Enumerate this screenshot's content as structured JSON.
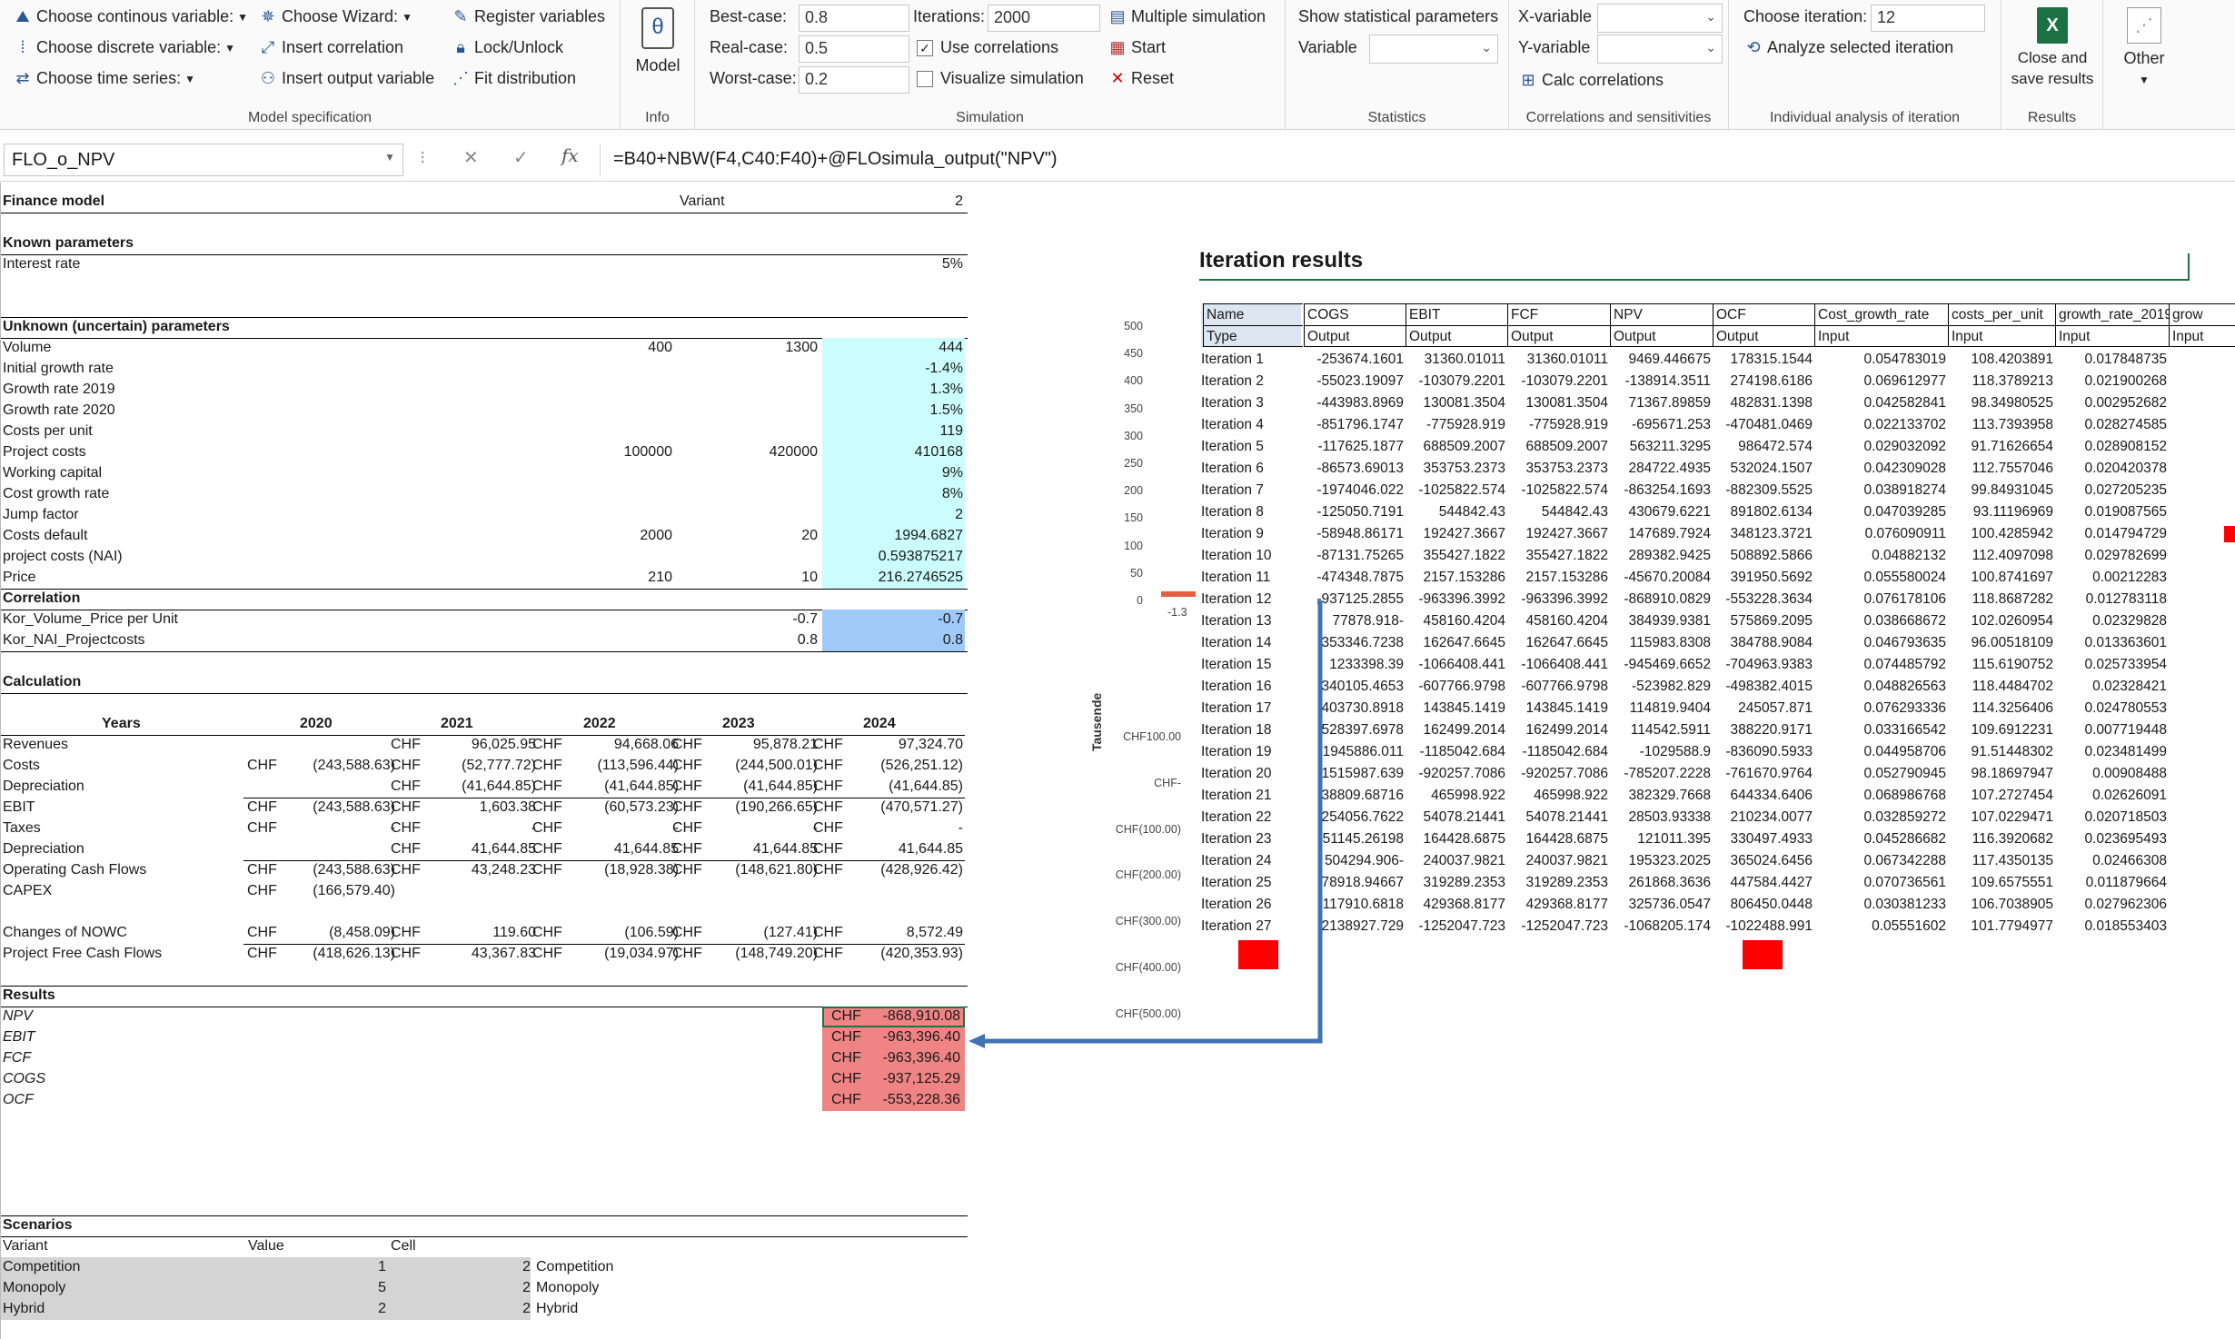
{
  "ribbon": {
    "model_spec": {
      "choose_continuous": "Choose continous variable:",
      "choose_discrete": "Choose discrete variable:",
      "choose_time_series": "Choose time series:",
      "choose_wizard": "Choose Wizard:",
      "insert_correlation": "Insert correlation",
      "insert_output": "Insert output variable",
      "register_variables": "Register variables",
      "lock_unlock": "Lock/Unlock",
      "fit_distribution": "Fit distribution",
      "group_label": "Model specification"
    },
    "info": {
      "model": "Model",
      "group_label": "Info"
    },
    "simulation": {
      "best_case_label": "Best-case:",
      "best_case_value": "0.8",
      "real_case_label": "Real-case:",
      "real_case_value": "0.5",
      "worst_case_label": "Worst-case:",
      "worst_case_value": "0.2",
      "iterations_label": "Iterations:",
      "iterations_value": "2000",
      "use_correlations": "Use correlations",
      "visualize": "Visualize simulation",
      "multiple": "Multiple simulation",
      "start": "Start",
      "reset": "Reset",
      "group_label": "Simulation"
    },
    "statistics": {
      "show_params": "Show statistical parameters",
      "variable": "Variable",
      "group_label": "Statistics"
    },
    "correlations": {
      "x_variable": "X-variable",
      "y_variable": "Y-variable",
      "calc": "Calc correlations",
      "group_label": "Correlations and sensitivities"
    },
    "iteration": {
      "choose_label": "Choose iteration:",
      "choose_value": "12",
      "analyze": "Analyze selected iteration",
      "group_label": "Individual analysis of iteration"
    },
    "results": {
      "close_save": "Close and save results",
      "group_label": "Results"
    },
    "other": {
      "label": "Other"
    }
  },
  "formula_bar": {
    "name_box": "FLO_o_NPV",
    "formula": "=B40+NBW(F4,C40:F40)+@FLOsimula_output(\"NPV\")"
  },
  "model": {
    "title": "Finance model",
    "variant_label": "Variant",
    "variant_value": "2",
    "known_header": "Known parameters",
    "interest_label": "Interest rate",
    "interest_value": "5%",
    "unknown_header": "Unknown (uncertain) parameters",
    "params": [
      {
        "name": "Volume",
        "a": "400",
        "b": "1300",
        "v": "444"
      },
      {
        "name": "Initial growth rate",
        "a": "",
        "b": "",
        "v": "-1.4%"
      },
      {
        "name": "Growth rate 2019",
        "a": "",
        "b": "",
        "v": "1.3%"
      },
      {
        "name": "Growth rate 2020",
        "a": "",
        "b": "",
        "v": "1.5%"
      },
      {
        "name": "Costs per unit",
        "a": "",
        "b": "",
        "v": "119"
      },
      {
        "name": "Project costs",
        "a": "100000",
        "b": "420000",
        "v": "410168"
      },
      {
        "name": "Working capital",
        "a": "",
        "b": "",
        "v": "9%"
      },
      {
        "name": "Cost growth rate",
        "a": "",
        "b": "",
        "v": "8%"
      },
      {
        "name": "Jump factor",
        "a": "",
        "b": "",
        "v": "2"
      },
      {
        "name": "Costs default",
        "a": "2000",
        "b": "20",
        "v": "1994.6827"
      },
      {
        "name": "project costs (NAI)",
        "a": "",
        "b": "",
        "v": "0.593875217"
      },
      {
        "name": "Price",
        "a": "210",
        "b": "10",
        "v": "216.2746525"
      }
    ],
    "correlation_header": "Correlation",
    "correlations": [
      {
        "name": "Kor_Volume_Price per Unit",
        "a": "-0.7",
        "v": "-0.7"
      },
      {
        "name": "Kor_NAI_Projectcosts",
        "a": "0.8",
        "v": "0.8"
      }
    ],
    "calc_header": "Calculation",
    "years_label": "Years",
    "years": [
      "2020",
      "2021",
      "2022",
      "2023",
      "2024"
    ],
    "rows": [
      {
        "name": "Revenues",
        "cells": [
          [
            "",
            ""
          ],
          [
            "CHF",
            "96,025.95"
          ],
          [
            "CHF",
            "94,668.06"
          ],
          [
            "CHF",
            "95,878.21"
          ],
          [
            "CHF",
            "97,324.70"
          ]
        ]
      },
      {
        "name": "Costs",
        "cells": [
          [
            "CHF",
            "(243,588.63)"
          ],
          [
            "CHF",
            "(52,777.72)"
          ],
          [
            "CHF",
            "(113,596.44)"
          ],
          [
            "CHF",
            "(244,500.01)"
          ],
          [
            "CHF",
            "(526,251.12)"
          ]
        ]
      },
      {
        "name": "Depreciation",
        "cells": [
          [
            "",
            ""
          ],
          [
            "CHF",
            "(41,644.85)"
          ],
          [
            "CHF",
            "(41,644.85)"
          ],
          [
            "CHF",
            "(41,644.85)"
          ],
          [
            "CHF",
            "(41,644.85)"
          ]
        ]
      },
      {
        "name": "EBIT",
        "cells": [
          [
            "CHF",
            "(243,588.63)"
          ],
          [
            "CHF",
            "1,603.38"
          ],
          [
            "CHF",
            "(60,573.23)"
          ],
          [
            "CHF",
            "(190,266.65)"
          ],
          [
            "CHF",
            "(470,571.27)"
          ]
        ]
      },
      {
        "name": "Taxes",
        "cells": [
          [
            "CHF",
            "-"
          ],
          [
            "CHF",
            "-"
          ],
          [
            "CHF",
            "-"
          ],
          [
            "CHF",
            "-"
          ],
          [
            "CHF",
            "-"
          ]
        ]
      },
      {
        "name": "Depreciation",
        "cells": [
          [
            "",
            ""
          ],
          [
            "CHF",
            "41,644.85"
          ],
          [
            "CHF",
            "41,644.85"
          ],
          [
            "CHF",
            "41,644.85"
          ],
          [
            "CHF",
            "41,644.85"
          ]
        ]
      },
      {
        "name": "Operating Cash Flows",
        "cells": [
          [
            "CHF",
            "(243,588.63)"
          ],
          [
            "CHF",
            "43,248.23"
          ],
          [
            "CHF",
            "(18,928.38)"
          ],
          [
            "CHF",
            "(148,621.80)"
          ],
          [
            "CHF",
            "(428,926.42)"
          ]
        ]
      },
      {
        "name": "CAPEX",
        "cells": [
          [
            "CHF",
            "(166,579.40)"
          ],
          [
            "",
            ""
          ],
          [
            "",
            ""
          ],
          [
            "",
            ""
          ],
          [
            "",
            ""
          ]
        ]
      }
    ],
    "rows2": [
      {
        "name": "Changes of NOWC",
        "cells": [
          [
            "CHF",
            "(8,458.09)"
          ],
          [
            "CHF",
            "119.60"
          ],
          [
            "CHF",
            "(106.59)"
          ],
          [
            "CHF",
            "(127.41)"
          ],
          [
            "CHF",
            "8,572.49"
          ]
        ]
      },
      {
        "name": "Project Free Cash Flows",
        "cells": [
          [
            "CHF",
            "(418,626.13)"
          ],
          [
            "CHF",
            "43,367.83"
          ],
          [
            "CHF",
            "(19,034.97)"
          ],
          [
            "CHF",
            "(148,749.20)"
          ],
          [
            "CHF",
            "(420,353.93)"
          ]
        ]
      }
    ],
    "results_header": "Results",
    "results": [
      {
        "name": "NPV",
        "cur": "CHF",
        "v": "-868,910.08"
      },
      {
        "name": "EBIT",
        "cur": "CHF",
        "v": "-963,396.40"
      },
      {
        "name": "FCF",
        "cur": "CHF",
        "v": "-963,396.40"
      },
      {
        "name": "COGS",
        "cur": "CHF",
        "v": "-937,125.29"
      },
      {
        "name": "OCF",
        "cur": "CHF",
        "v": "-553,228.36"
      }
    ],
    "scenarios_header": "Scenarios",
    "scen_cols": [
      "Variant",
      "Value",
      "Cell"
    ],
    "scenarios": [
      {
        "name": "Competition",
        "value": "1",
        "cell": "2",
        "label": "Competition"
      },
      {
        "name": "Monopoly",
        "value": "5",
        "cell": "2",
        "label": "Monopoly"
      },
      {
        "name": "Hybrid",
        "value": "2",
        "cell": "2",
        "label": "Hybrid"
      }
    ]
  },
  "chart1": {
    "ticks": [
      "500",
      "450",
      "400",
      "350",
      "300",
      "250",
      "200",
      "150",
      "100",
      "50",
      "0"
    ],
    "bar_label": "-1.3"
  },
  "chart2": {
    "ylabel": "Tausende",
    "ticks": [
      "CHF100.00",
      "CHF-",
      "CHF(100.00)",
      "CHF(200.00)",
      "CHF(300.00)",
      "CHF(400.00)",
      "CHF(500.00)"
    ]
  },
  "iter": {
    "title": "Iteration results",
    "headers": [
      "Name",
      "COGS",
      "EBIT",
      "FCF",
      "NPV",
      "OCF",
      "Cost_growth_rate",
      "costs_per_unit",
      "growth_rate_2019",
      "grow"
    ],
    "types": [
      "Type",
      "Output",
      "Output",
      "Output",
      "Output",
      "Output",
      "Input",
      "Input",
      "Input",
      "Input"
    ],
    "rows": [
      [
        "Iteration 1",
        "-253674.1601",
        "31360.01011",
        "31360.01011",
        "9469.446675",
        "178315.1544",
        "0.054783019",
        "108.4203891",
        "0.017848735"
      ],
      [
        "Iteration 2",
        "-55023.19097",
        "-103079.2201",
        "-103079.2201",
        "-138914.3511",
        "274198.6186",
        "0.069612977",
        "118.3789213",
        "0.021900268"
      ],
      [
        "Iteration 3",
        "-443983.8969",
        "130081.3504",
        "130081.3504",
        "71367.89859",
        "482831.1398",
        "0.042582841",
        "98.34980525",
        "0.002952682"
      ],
      [
        "Iteration 4",
        "-851796.1747",
        "-775928.919",
        "-775928.919",
        "-695671.253",
        "-470481.0469",
        "0.022133702",
        "113.7393958",
        "0.028274585"
      ],
      [
        "Iteration 5",
        "-117625.1877",
        "688509.2007",
        "688509.2007",
        "563211.3295",
        "986472.574",
        "0.029032092",
        "91.71626654",
        "0.028908152"
      ],
      [
        "Iteration 6",
        "-86573.69013",
        "353753.2373",
        "353753.2373",
        "284722.4935",
        "532024.1507",
        "0.042309028",
        "112.7557046",
        "0.020420378"
      ],
      [
        "Iteration 7",
        "-1974046.022",
        "-1025822.574",
        "-1025822.574",
        "-863254.1693",
        "-882309.5525",
        "0.038918274",
        "99.84931045",
        "0.027205235"
      ],
      [
        "Iteration 8",
        "-125050.7191",
        "544842.43",
        "544842.43",
        "430679.6221",
        "891802.6134",
        "0.047039285",
        "93.11196969",
        "0.019087565"
      ],
      [
        "Iteration 9",
        "-58948.86171",
        "192427.3667",
        "192427.3667",
        "147689.7924",
        "348123.3721",
        "0.076090911",
        "100.4285942",
        "0.014794729"
      ],
      [
        "Iteration 10",
        "-87131.75265",
        "355427.1822",
        "355427.1822",
        "289382.9425",
        "508892.5866",
        "0.04882132",
        "112.4097098",
        "0.029782699"
      ],
      [
        "Iteration 11",
        "-474348.7875",
        "2157.153286",
        "2157.153286",
        "-45670.20084",
        "391950.5692",
        "0.055580024",
        "100.8741697",
        "0.00212283"
      ],
      [
        "Iteration 12",
        "-937125.2855",
        "-963396.3992",
        "-963396.3992",
        "-868910.0829",
        "-553228.3634",
        "0.076178106",
        "118.8687282",
        "0.012783118"
      ],
      [
        "Iteration 13",
        "-77878.918",
        "458160.4204",
        "458160.4204",
        "384939.9381",
        "575869.2095",
        "0.038668672",
        "102.0260954",
        "0.02329828"
      ],
      [
        "Iteration 14",
        "353346.7238",
        "162647.6645",
        "162647.6645",
        "115983.8308",
        "384788.9084",
        "0.046793635",
        "96.00518109",
        "0.013363601"
      ],
      [
        "Iteration 15",
        "1233398.39",
        "-1066408.441",
        "-1066408.441",
        "-945469.6652",
        "-704963.9383",
        "0.074485792",
        "115.6190752",
        "0.025733954"
      ],
      [
        "Iteration 16",
        "340105.4653",
        "-607766.9798",
        "-607766.9798",
        "-523982.829",
        "-498382.4015",
        "0.048826563",
        "118.4484702",
        "0.02328421"
      ],
      [
        "Iteration 17",
        "403730.8918",
        "143845.1419",
        "143845.1419",
        "114819.9404",
        "245057.871",
        "0.076293336",
        "114.3256406",
        "0.024780553"
      ],
      [
        "Iteration 18",
        "528397.6978",
        "162499.2014",
        "162499.2014",
        "114542.5911",
        "388220.9171",
        "0.033166542",
        "109.6912231",
        "0.007719448"
      ],
      [
        "Iteration 19",
        "1945886.011",
        "-1185042.684",
        "-1185042.684",
        "-1029588.9",
        "-836090.5933",
        "0.044958706",
        "91.51448302",
        "0.023481499"
      ],
      [
        "Iteration 20",
        "1515987.639",
        "-920257.7086",
        "-920257.7086",
        "-785207.2228",
        "-761670.9764",
        "0.052790945",
        "98.18697947",
        "0.00908488"
      ],
      [
        "Iteration 21",
        "38809.68716",
        "465998.922",
        "465998.922",
        "382329.7668",
        "644334.6406",
        "0.068986768",
        "107.2727454",
        "0.02626091"
      ],
      [
        "Iteration 22",
        "254056.7622",
        "54078.21441",
        "54078.21441",
        "28503.93338",
        "210234.0077",
        "0.032859272",
        "107.0229471",
        "0.020718503"
      ],
      [
        "Iteration 23",
        "51145.26198",
        "164428.6875",
        "164428.6875",
        "121011.395",
        "330497.4933",
        "0.045286682",
        "116.3920682",
        "0.023695493"
      ],
      [
        "Iteration 24",
        "-504294.906",
        "240037.9821",
        "240037.9821",
        "195323.2025",
        "365024.6456",
        "0.067342288",
        "117.4350135",
        "0.02466308"
      ],
      [
        "Iteration 25",
        "78918.94667",
        "319289.2353",
        "319289.2353",
        "261868.3636",
        "447584.4427",
        "0.070736561",
        "109.6575551",
        "0.011879664"
      ],
      [
        "Iteration 26",
        "117910.6818",
        "429368.8177",
        "429368.8177",
        "325736.0547",
        "806450.0448",
        "0.030381233",
        "106.7038905",
        "0.027962306"
      ],
      [
        "Iteration 27",
        "2138927.729",
        "-1252047.723",
        "-1252047.723",
        "-1068205.174",
        "-1022488.991",
        "0.05551602",
        "101.7794977",
        "0.018553403"
      ]
    ]
  }
}
